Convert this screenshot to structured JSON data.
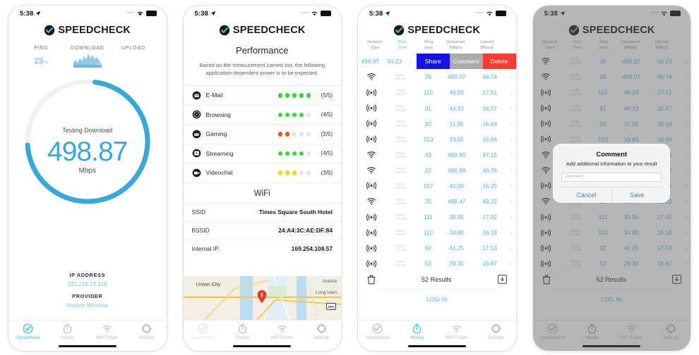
{
  "brand": {
    "name": "SPEEDCHECK"
  },
  "statusbar": {
    "time": "5:38",
    "location_icon": "location-arrow-icon",
    "wifi_icon": "wifi-icon",
    "battery_icon": "battery-full-icon"
  },
  "tabbar": {
    "items": [
      {
        "label": "Speedcheck",
        "icon": "speedcheck-check-icon"
      },
      {
        "label": "History",
        "icon": "stopwatch-icon"
      },
      {
        "label": "WiFi Finder",
        "icon": "wifi-icon"
      },
      {
        "label": "Settings",
        "icon": "gear-icon"
      }
    ]
  },
  "panel1": {
    "metrics": [
      {
        "label": "PING",
        "value": "23",
        "unit": "ms"
      },
      {
        "label": "DOWNLOAD",
        "value": "",
        "unit": ""
      },
      {
        "label": "UPLOAD",
        "value": "",
        "unit": ""
      }
    ],
    "gauge": {
      "status": "Testing Download",
      "value": "498.87",
      "unit": "Mbps",
      "progress_pct": 72,
      "accent": "#38a8da",
      "track": "#f0f0f0"
    },
    "ip": {
      "label": "IP ADDRESS",
      "value": "231.219.73.128"
    },
    "provider": {
      "label": "PROVIDER",
      "value": "Verizon Wireless"
    },
    "active_tab": 0
  },
  "panel2": {
    "title": "Performance",
    "description": "Based on the measurement carried out, the following application-dependent power is to be expected.",
    "performance": [
      {
        "name": "E-Mail",
        "icon": "envelope-icon",
        "filled": 5,
        "total": 5,
        "score": "(5/5)",
        "color": "#3bd43b"
      },
      {
        "name": "Browsing",
        "icon": "compass-icon",
        "filled": 4,
        "total": 5,
        "score": "(4/5)",
        "color": "#3bd43b"
      },
      {
        "name": "Gaming",
        "icon": "gamepad-icon",
        "filled": 2,
        "total": 5,
        "score": "(2/5)",
        "color": "#ef5524"
      },
      {
        "name": "Streaming",
        "icon": "play-circle-icon",
        "filled": 4,
        "total": 5,
        "score": "(4/5)",
        "color": "#3bd43b"
      },
      {
        "name": "Videochat",
        "icon": "video-camera-icon",
        "filled": 3,
        "total": 5,
        "score": "(3/5)",
        "color": "#f5d512"
      }
    ],
    "wifi_title": "WiFi",
    "wifi_rows": [
      {
        "key": "SSID",
        "value": "Times Square South Hotel"
      },
      {
        "key": "BSSID",
        "value": "24:A4:3C:AE:DF:84"
      },
      {
        "key": "Internal IP",
        "value": "169.254.108.57"
      }
    ],
    "map": {
      "labels": [
        "Union City",
        "Astoria",
        "Long Islan"
      ],
      "badge": "29A",
      "pin": "map-pin-icon"
    },
    "active_tab": 0
  },
  "panel3": {
    "columns": [
      "Network Type",
      "Date Time",
      "Ping [ms]",
      "Download [Mbps]",
      "Upload [Mbps]"
    ],
    "columns_split": [
      {
        "l1": "Network",
        "l2": "Type"
      },
      {
        "l1": "Date",
        "l2": "Time"
      },
      {
        "l1": "Ping",
        "l2": "[ms]"
      },
      {
        "l1": "Download",
        "l2": "[Mbps]"
      },
      {
        "l1": "Upload",
        "l2": "[Mbps]"
      }
    ],
    "swipe_row": {
      "ping": "498.87",
      "download": "50.23",
      "actions": [
        {
          "label": "Share",
          "color": "#1414e8"
        },
        {
          "label": "Comment",
          "color": "#aaaaaa"
        },
        {
          "label": "Delete",
          "color": "#fd3b30"
        }
      ]
    },
    "rows": [
      {
        "net": "wifi",
        "date": "5/9/19,",
        "time": "5:58 AM",
        "ping": "28",
        "download": "499.07",
        "upload": "46.74"
      },
      {
        "net": "cell",
        "date": "5/9/19,",
        "time": "5:38 AM",
        "ping": "115",
        "download": "48.03",
        "upload": "17.51"
      },
      {
        "net": "cell",
        "date": "5/9/19,",
        "time": "5:34 AM",
        "ping": "91",
        "download": "44.23",
        "upload": "16.57"
      },
      {
        "net": "cell",
        "date": "5/9/19,",
        "time": "5:20 AM",
        "ping": "93",
        "download": "31.05",
        "upload": "16.64"
      },
      {
        "net": "cell",
        "date": "5/9/19,",
        "time": "5:18 AM",
        "ping": "153",
        "download": "33.85",
        "upload": "16.64"
      },
      {
        "net": "wifi",
        "date": "5/9/19,",
        "time": "5:12 AM",
        "ping": "43",
        "download": "499.80",
        "upload": "47.15"
      },
      {
        "net": "wifi",
        "date": "5/9/19,",
        "time": "5:06 AM",
        "ping": "22",
        "download": "496.68",
        "upload": "46.76"
      },
      {
        "net": "cell",
        "date": "5/9/19,",
        "time": "5:02 AM",
        "ping": "167",
        "download": "45.09",
        "upload": "16.25"
      },
      {
        "net": "wifi",
        "date": "5/9/19,",
        "time": "4:50 AM",
        "ping": "25",
        "download": "498.47",
        "upload": "49.22"
      },
      {
        "net": "cell",
        "date": "5/9/19,",
        "time": "4:49 AM",
        "ping": "111",
        "download": "30.86",
        "upload": "17.02"
      },
      {
        "net": "cell",
        "date": "5/9/19,",
        "time": "4:38 AM",
        "ping": "110",
        "download": "34.80",
        "upload": "16.18"
      },
      {
        "net": "cell",
        "date": "5/9/19,",
        "time": "4:21 AM",
        "ping": "92",
        "download": "41.25",
        "upload": "17.53"
      },
      {
        "net": "cell",
        "date": "5/9/19,",
        "time": "2:53 AM",
        "ping": "53",
        "download": "29.30",
        "upload": "16.87"
      }
    ],
    "footer": {
      "delete_icon": "trash-icon",
      "results": "52 Results",
      "download_icon": "download-box-icon"
    },
    "login": "LOG IN",
    "active_tab": 1
  },
  "panel4": {
    "rows": [
      {
        "net": "wifi",
        "date": "5/9/19,",
        "time": "6:38 AM",
        "ping": "35",
        "download": "498.87",
        "upload": "50.23"
      },
      {
        "net": "wifi",
        "date": "5/9/19,",
        "time": "5:58 AM",
        "ping": "28",
        "download": "499.07",
        "upload": "46.74"
      },
      {
        "net": "cell",
        "date": "5/9/19,",
        "time": "5:38 AM",
        "ping": "115",
        "download": "48.03",
        "upload": "17.51"
      },
      {
        "net": "cell",
        "date": "5/9/19,",
        "time": "5:34 AM",
        "ping": "91",
        "download": "44.23",
        "upload": "16.57"
      },
      {
        "net": "cell",
        "date": "5/9/19,",
        "time": "5:20 AM",
        "ping": "93",
        "download": "31.05",
        "upload": "16.64"
      },
      {
        "net": "cell",
        "date": "5/9/19,",
        "time": "5:18 AM",
        "ping": "153",
        "download": "33.85",
        "upload": "16.64"
      },
      {
        "net": "wifi",
        "date": "5/9/19,",
        "time": "5:12 AM",
        "ping": "43",
        "download": "499.80",
        "upload": "47.15"
      },
      {
        "net": "wifi",
        "date": "5/9/19,",
        "time": "5:06 AM",
        "ping": "22",
        "download": "496.68",
        "upload": "46.76"
      },
      {
        "net": "cell",
        "date": "5/9/19,",
        "time": "5:02 AM",
        "ping": "167",
        "download": "45.09",
        "upload": "16.25"
      },
      {
        "net": "wifi",
        "date": "5/9/19,",
        "time": "4:50 AM",
        "ping": "25",
        "download": "498.47",
        "upload": "49.22"
      },
      {
        "net": "cell",
        "date": "5/9/19,",
        "time": "4:49 AM",
        "ping": "111",
        "download": "30.86",
        "upload": "17.02"
      },
      {
        "net": "cell",
        "date": "5/9/19,",
        "time": "4:38 AM",
        "ping": "110",
        "download": "34.80",
        "upload": "16.18"
      },
      {
        "net": "cell",
        "date": "5/9/19,",
        "time": "4:21 AM",
        "ping": "92",
        "download": "41.25",
        "upload": "17.53"
      },
      {
        "net": "cell",
        "date": "5/9/19,",
        "time": "2:53 AM",
        "ping": "53",
        "download": "29.30",
        "upload": "16.87"
      }
    ],
    "footer": {
      "results": "52 Results"
    },
    "login": "LOG IN",
    "modal": {
      "title": "Comment",
      "subtitle": "Add additional information to your result",
      "input_placeholder": "Comment",
      "input_value": "",
      "cancel": "Cancel",
      "save": "Save"
    },
    "active_tab": 1
  }
}
